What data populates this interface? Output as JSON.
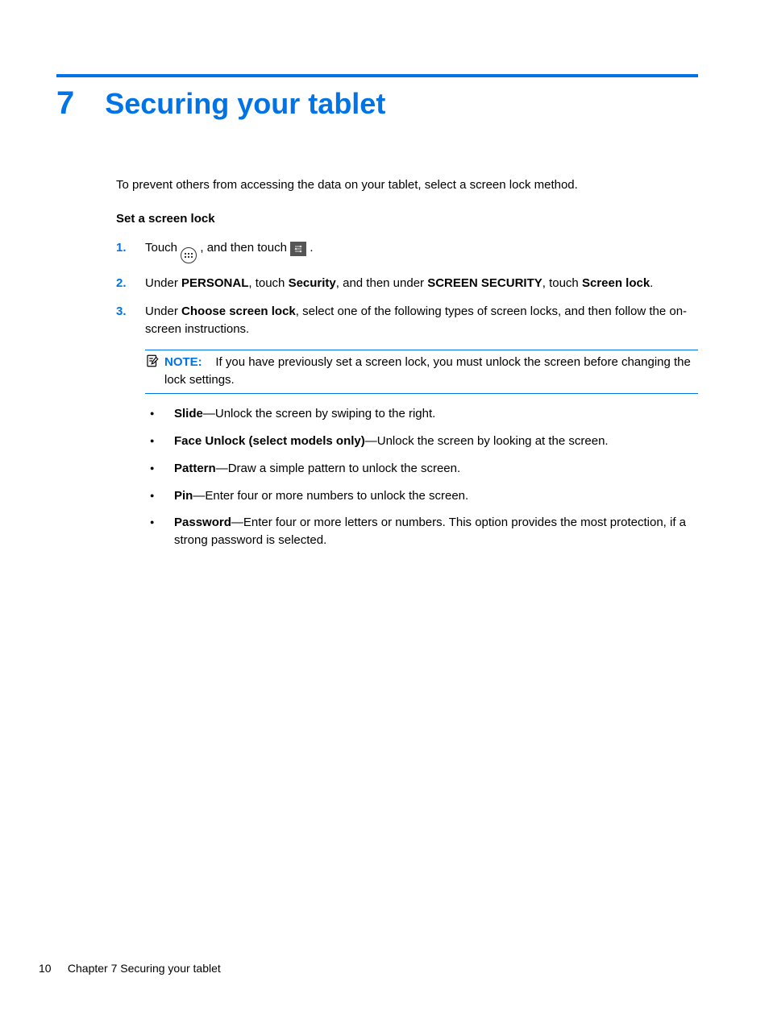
{
  "chapter": {
    "number": "7",
    "title": "Securing your tablet"
  },
  "intro": "To prevent others from accessing the data on your tablet, select a screen lock method.",
  "subhead": "Set a screen lock",
  "steps": {
    "s1_a": "Touch ",
    "s1_b": ", and then touch ",
    "s1_c": ".",
    "s2_pre": "Under ",
    "s2_b1": "PERSONAL",
    "s2_mid1": ", touch ",
    "s2_b2": "Security",
    "s2_mid2": ", and then under ",
    "s2_b3": "SCREEN SECURITY",
    "s2_mid3": ", touch ",
    "s2_b4": "Screen lock",
    "s2_end": ".",
    "s3_pre": "Under ",
    "s3_b1": "Choose screen lock",
    "s3_rest": ", select one of the following types of screen locks, and then follow the on-screen instructions."
  },
  "note": {
    "label": "NOTE:",
    "text": "If you have previously set a screen lock, you must unlock the screen before changing the lock settings."
  },
  "bullets": {
    "b1_t": "Slide",
    "b1_r": "—Unlock the screen by swiping to the right.",
    "b2_t": "Face Unlock (select models only)",
    "b2_r": "—Unlock the screen by looking at the screen.",
    "b3_t": "Pattern",
    "b3_r": "—Draw a simple pattern to unlock the screen.",
    "b4_t": "Pin",
    "b4_r": "—Enter four or more numbers to unlock the screen.",
    "b5_t": "Password",
    "b5_r": "—Enter four or more letters or numbers. This option provides the most protection, if a strong password is selected."
  },
  "footer": {
    "page": "10",
    "text": "Chapter 7   Securing your tablet"
  }
}
